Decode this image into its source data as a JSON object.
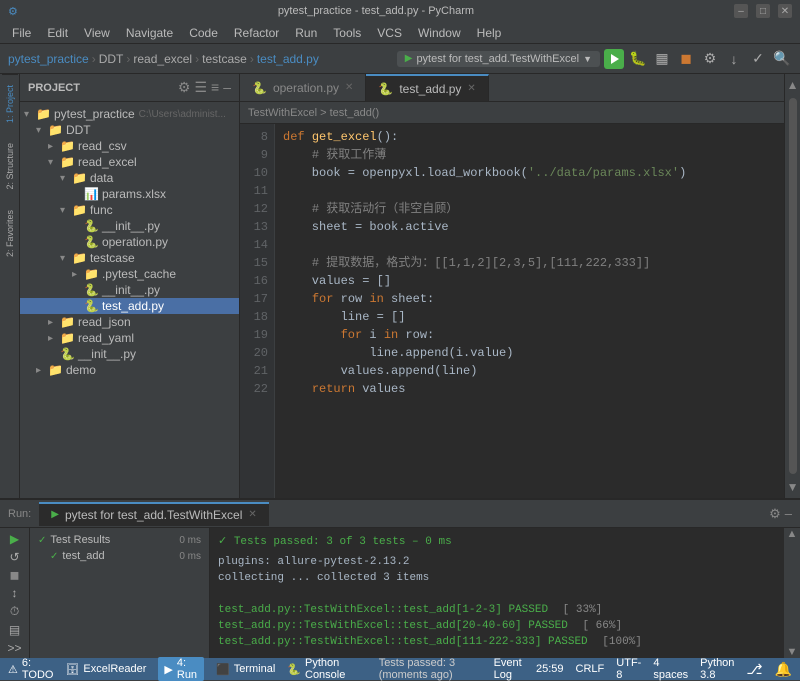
{
  "titlebar": {
    "title": "pytest_practice - test_add.py - PyCharm",
    "icons": [
      "–",
      "□",
      "✕"
    ]
  },
  "menubar": {
    "items": [
      "File",
      "Edit",
      "View",
      "Navigate",
      "Code",
      "Refactor",
      "Run",
      "Tools",
      "VCS",
      "Window",
      "Help"
    ]
  },
  "toolbar": {
    "breadcrumb": [
      "pytest_practice",
      "DDT",
      "read_excel",
      "testcase",
      "test_add.py"
    ],
    "run_config": "pytest for test_add.TestWithExcel",
    "run_label": "▶"
  },
  "sidebar": {
    "title": "Project",
    "root": "pytest_practice",
    "root_path": "C:\\Users\\administ...",
    "tree": [
      {
        "label": "pytest_practice",
        "type": "root",
        "indent": 0,
        "expanded": true
      },
      {
        "label": "DDT",
        "type": "folder",
        "indent": 1,
        "expanded": true
      },
      {
        "label": "read_csv",
        "type": "folder",
        "indent": 2,
        "expanded": false
      },
      {
        "label": "read_excel",
        "type": "folder",
        "indent": 2,
        "expanded": true
      },
      {
        "label": "data",
        "type": "folder",
        "indent": 3,
        "expanded": true
      },
      {
        "label": "params.xlsx",
        "type": "xlsx",
        "indent": 4,
        "expanded": false
      },
      {
        "label": "func",
        "type": "folder",
        "indent": 3,
        "expanded": true
      },
      {
        "label": "__init__.py",
        "type": "pyinit",
        "indent": 4,
        "expanded": false
      },
      {
        "label": "operation.py",
        "type": "py",
        "indent": 4,
        "expanded": false
      },
      {
        "label": "testcase",
        "type": "folder",
        "indent": 3,
        "expanded": true
      },
      {
        "label": ".pytest_cache",
        "type": "folder",
        "indent": 4,
        "expanded": false
      },
      {
        "label": "__init__.py",
        "type": "pyinit",
        "indent": 4,
        "expanded": false
      },
      {
        "label": "test_add.py",
        "type": "py",
        "indent": 4,
        "expanded": false,
        "selected": true
      },
      {
        "label": "read_json",
        "type": "folder",
        "indent": 2,
        "expanded": false
      },
      {
        "label": "read_yaml",
        "type": "folder",
        "indent": 2,
        "expanded": false
      },
      {
        "label": "__init__.py",
        "type": "pyinit",
        "indent": 2,
        "expanded": false
      },
      {
        "label": "demo",
        "type": "folder",
        "indent": 1,
        "expanded": false
      }
    ]
  },
  "editor": {
    "tabs": [
      {
        "label": "operation.py",
        "active": false
      },
      {
        "label": "test_add.py",
        "active": true
      }
    ],
    "breadcrumb": "TestWithExcel  >  test_add()",
    "lines": [
      {
        "num": "8",
        "code": "    <kw>def</kw> <fn>get_excel</fn>():"
      },
      {
        "num": "9",
        "code": "        <cm># 获取工作薄</cm>"
      },
      {
        "num": "10",
        "code": "        book = openpyxl.load_workbook(<str>'../data/params.xlsx'</str>)"
      },
      {
        "num": "11",
        "code": ""
      },
      {
        "num": "12",
        "code": "        <cm># 获取活动行（非空自顾）</cm>"
      },
      {
        "num": "13",
        "code": "        sheet = book.active"
      },
      {
        "num": "14",
        "code": ""
      },
      {
        "num": "15",
        "code": "        <cm># 提取数据，格式为：[[1,1,2][2,3,5],[111,222,333]]</cm>"
      },
      {
        "num": "16",
        "code": "        values = []"
      },
      {
        "num": "17",
        "code": "        <kw>for</kw> row <kw>in</kw> sheet:"
      },
      {
        "num": "18",
        "code": "            line = []"
      },
      {
        "num": "19",
        "code": "            <kw>for</kw> i <kw>in</kw> row:"
      },
      {
        "num": "20",
        "code": "                line.append(i.value)"
      },
      {
        "num": "21",
        "code": "            values.append(line)"
      },
      {
        "num": "22",
        "code": "        <kw>return</kw> values"
      }
    ]
  },
  "run_panel": {
    "tab_label": "pytest for test_add.TestWithExcel",
    "status_bar": {
      "text": "Tests passed: 3 of 3 tests – 0 ms"
    },
    "test_results": {
      "header": "Test Results",
      "header_time": "0 ms",
      "item": "test_add",
      "item_time": "0 ms"
    },
    "output": [
      {
        "text": "plugins: allure-pytest-2.13.2",
        "type": "normal"
      },
      {
        "text": "collecting ... collected 3 items",
        "type": "normal"
      },
      {
        "text": "",
        "type": "normal"
      },
      {
        "text": "test_add.py::TestWithExcel::test_add[1-2-3] PASSED",
        "type": "pass",
        "percent": "[ 33%]"
      },
      {
        "text": "test_add.py::TestWithExcel::test_add[20-40-60] PASSED",
        "type": "pass",
        "percent": "[ 66%]"
      },
      {
        "text": "test_add.py::TestWithExcel::test_add[111-222-333] PASSED",
        "type": "pass",
        "percent": "[100%]"
      }
    ]
  },
  "statusbar": {
    "left": [
      {
        "label": "6: TODO"
      },
      {
        "label": "ExcelReader"
      },
      {
        "label": "4: Run"
      },
      {
        "label": "Terminal"
      },
      {
        "label": "Python Console"
      }
    ],
    "right": [
      {
        "label": "Event Log"
      },
      {
        "label": "25:59"
      },
      {
        "label": "CRLF"
      },
      {
        "label": "UTF-8"
      },
      {
        "label": "4 spaces"
      },
      {
        "label": "Python 3.8"
      }
    ],
    "bottom_msg": "Tests passed: 3 (moments ago)"
  },
  "colors": {
    "accent": "#4a8cc2",
    "pass": "#4aae4a",
    "bg_editor": "#2b2b2b",
    "bg_sidebar": "#3c3f41",
    "status_bar": "#3d6185"
  }
}
